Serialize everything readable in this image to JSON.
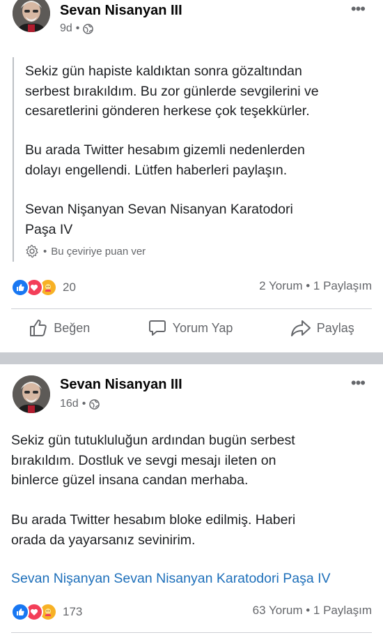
{
  "posts": [
    {
      "author": "Sevan Nisanyan III",
      "time": "9d",
      "privacy_icon": "globe-icon",
      "paragraphs": [
        "Sekiz gün hapiste kaldıktan sonra gözaltından\nserbest bırakıldım. Bu zor günlerde sevgilerini ve\ncesaretlerini gönderen herkese çok teşekkürler.",
        "Bu arada Twitter hesabım gizemli nedenlerden\ndolayı engellendi. Lütfen haberleri paylaşın.",
        "Sevan Nişanyan Sevan Nisanyan Karatodori\nPaşa IV"
      ],
      "translate_rating": "Bu çeviriye puan ver",
      "reaction_count": "20",
      "comments": "2 Yorum",
      "shares": "1 Paylaşım",
      "actions": {
        "like": "Beğen",
        "comment": "Yorum Yap",
        "share": "Paylaş"
      }
    },
    {
      "author": "Sevan Nisanyan III",
      "time": "16d",
      "privacy_icon": "globe-icon",
      "paragraphs": [
        "Sekiz gün tutukluluğun ardından bugün serbest\nbırakıldım. Dostluk ve sevgi mesajı ileten on\nbinlerce güzel insana candan merhaba.",
        "Bu arada Twitter hesabım bloke edilmiş. Haberi\norada da yayarsanız sevinirim."
      ],
      "link": "Sevan Nişanyan Sevan Nisanyan Karatodori Paşa IV",
      "reaction_count": "173",
      "comments": "63 Yorum",
      "shares": "1 Paylaşım"
    }
  ],
  "separator": "•",
  "more_icon": "•••",
  "colors": {
    "like": "#1877f2",
    "love": "#f33e58",
    "care": "#f7b125",
    "link": "#1d6fba",
    "muted": "#65676b"
  }
}
